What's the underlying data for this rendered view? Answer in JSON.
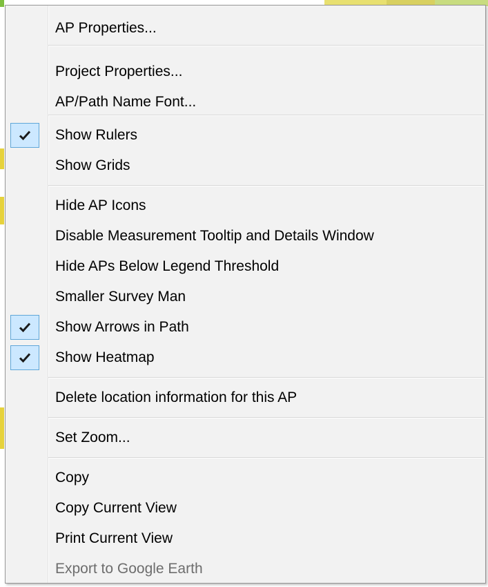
{
  "context_menu": {
    "items": [
      {
        "label": "AP Properties...",
        "checked": false,
        "enabled": true
      },
      {
        "label": "Project Properties...",
        "checked": false,
        "enabled": true
      },
      {
        "label": "AP/Path Name Font...",
        "checked": false,
        "enabled": true
      },
      {
        "label": "Show Rulers",
        "checked": true,
        "enabled": true
      },
      {
        "label": "Show Grids",
        "checked": false,
        "enabled": true
      },
      {
        "label": "Hide AP Icons",
        "checked": false,
        "enabled": true
      },
      {
        "label": "Disable Measurement Tooltip and Details Window",
        "checked": false,
        "enabled": true
      },
      {
        "label": "Hide APs Below Legend Threshold",
        "checked": false,
        "enabled": true
      },
      {
        "label": "Smaller Survey Man",
        "checked": false,
        "enabled": true
      },
      {
        "label": "Show Arrows in Path",
        "checked": true,
        "enabled": true
      },
      {
        "label": "Show Heatmap",
        "checked": true,
        "enabled": true
      },
      {
        "label": "Delete location information for this AP",
        "checked": false,
        "enabled": true
      },
      {
        "label": "Set Zoom...",
        "checked": false,
        "enabled": true
      },
      {
        "label": "Copy",
        "checked": false,
        "enabled": true
      },
      {
        "label": "Copy Current View",
        "checked": false,
        "enabled": true
      },
      {
        "label": "Print Current View",
        "checked": false,
        "enabled": true
      },
      {
        "label": "Export to Google Earth",
        "checked": false,
        "enabled": false
      }
    ],
    "colors": {
      "menu_background": "#f2f2f2",
      "check_highlight": "#cce8ff",
      "check_border": "#5fa6d8",
      "disabled_text": "#6d6d6d"
    }
  }
}
